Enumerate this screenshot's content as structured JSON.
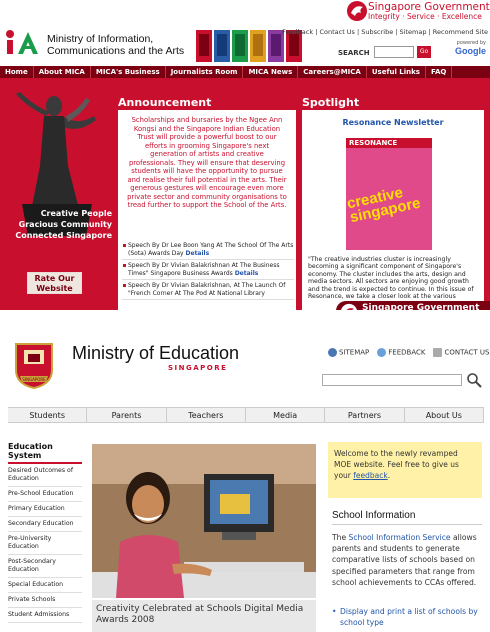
{
  "mica": {
    "sg_title": "Singapore Government",
    "sg_sub": "Integrity · Service · Excellence",
    "org_line1": "Ministry of Information,",
    "org_line2": "Communications and the Arts",
    "top_links": "Feedback | Contact Us | Subscribe | Sitemap | Recommend Site",
    "search_label": "SEARCH",
    "go_label": "Go",
    "powered_label": "powered by",
    "google_label": "Google",
    "nav": [
      "Home",
      "About MICA",
      "MICA's Business",
      "Journalists Room",
      "MICA News",
      "Careers@MICA",
      "Useful Links",
      "FAQ"
    ],
    "slogan_1": "Creative People",
    "slogan_2": "Gracious Community",
    "slogan_3": "Connected Singapore",
    "rate_label_1": "Rate Our",
    "rate_label_2": "Website",
    "announcement_title": "Announcement",
    "announcement_quote": "Scholarships and bursaries by the Ngee Ann Kongsi and the Singapore Indian Education Trust will provide a powerful boost to our efforts in grooming Singapore's next generation of artists and creative professionals. They will ensure that deserving students will have the opportunity to pursue and realise their full potential in the arts. Their generous gestures will encourage even more private sector and community organisations to tread further to support the School of the Arts.",
    "announcements": [
      {
        "text": "Speech By Dr Lee Boon Yang At The School Of The Arts (Sota) Awards Day",
        "details": "Details"
      },
      {
        "text": "Speech By Dr Vivian Balakrishnan At The Business Times\" Singapore Business Awards",
        "details": "Details"
      },
      {
        "text": "Speech By Dr Vivian Balakrishnan, At The Launch Of \"French Corner At The Pod At National Library",
        "details": ""
      }
    ],
    "spotlight_title": "Spotlight",
    "spotlight_heading": "Resonance Newsletter",
    "mag_masthead": "RESONANCE",
    "mag_cover_1": "creative",
    "mag_cover_2": "singapore",
    "spotlight_text": "\"The creative industries cluster is increasingly becoming a significant component of Singapore's economy. The cluster includes the arts, design and media sectors. All sectors are enjoying good growth and the trend is expected to continue. In this issue of Resonance, we take a closer look at the various"
  },
  "moe": {
    "title": "Ministry of Education",
    "subtitle": "SINGAPORE",
    "crest_text": "SINGAPORE",
    "sitemap": "SITEMAP",
    "feedback": "FEEDBACK",
    "contact": "CONTACT US",
    "nav": [
      "Students",
      "Parents",
      "Teachers",
      "Media",
      "Partners",
      "About Us"
    ],
    "side_heading": "Education System",
    "side_items": [
      "Desired Outcomes of Education",
      "Pre-School Education",
      "Primary Education",
      "Secondary Education",
      "Pre-University Education",
      "Post-Secondary Education",
      "Special Education",
      "Private Schools",
      "Student Admissions"
    ],
    "feature_caption": "Creativity Celebrated at Schools Digital Media Awards 2008",
    "welcome_pre": "Welcome to the newly revamped MOE website. Feel free to give us your ",
    "welcome_link": "feedback",
    "welcome_post": ".",
    "school_info_heading": "School Information",
    "school_info_pre": "The ",
    "school_info_link": "School Information Service",
    "school_info_post": " allows parents and students to generate comparative lists of schools based on specified parameters that range from school achievements to CCAs offered.",
    "school_info_bullet": "Display and print a list of schools by school type"
  }
}
